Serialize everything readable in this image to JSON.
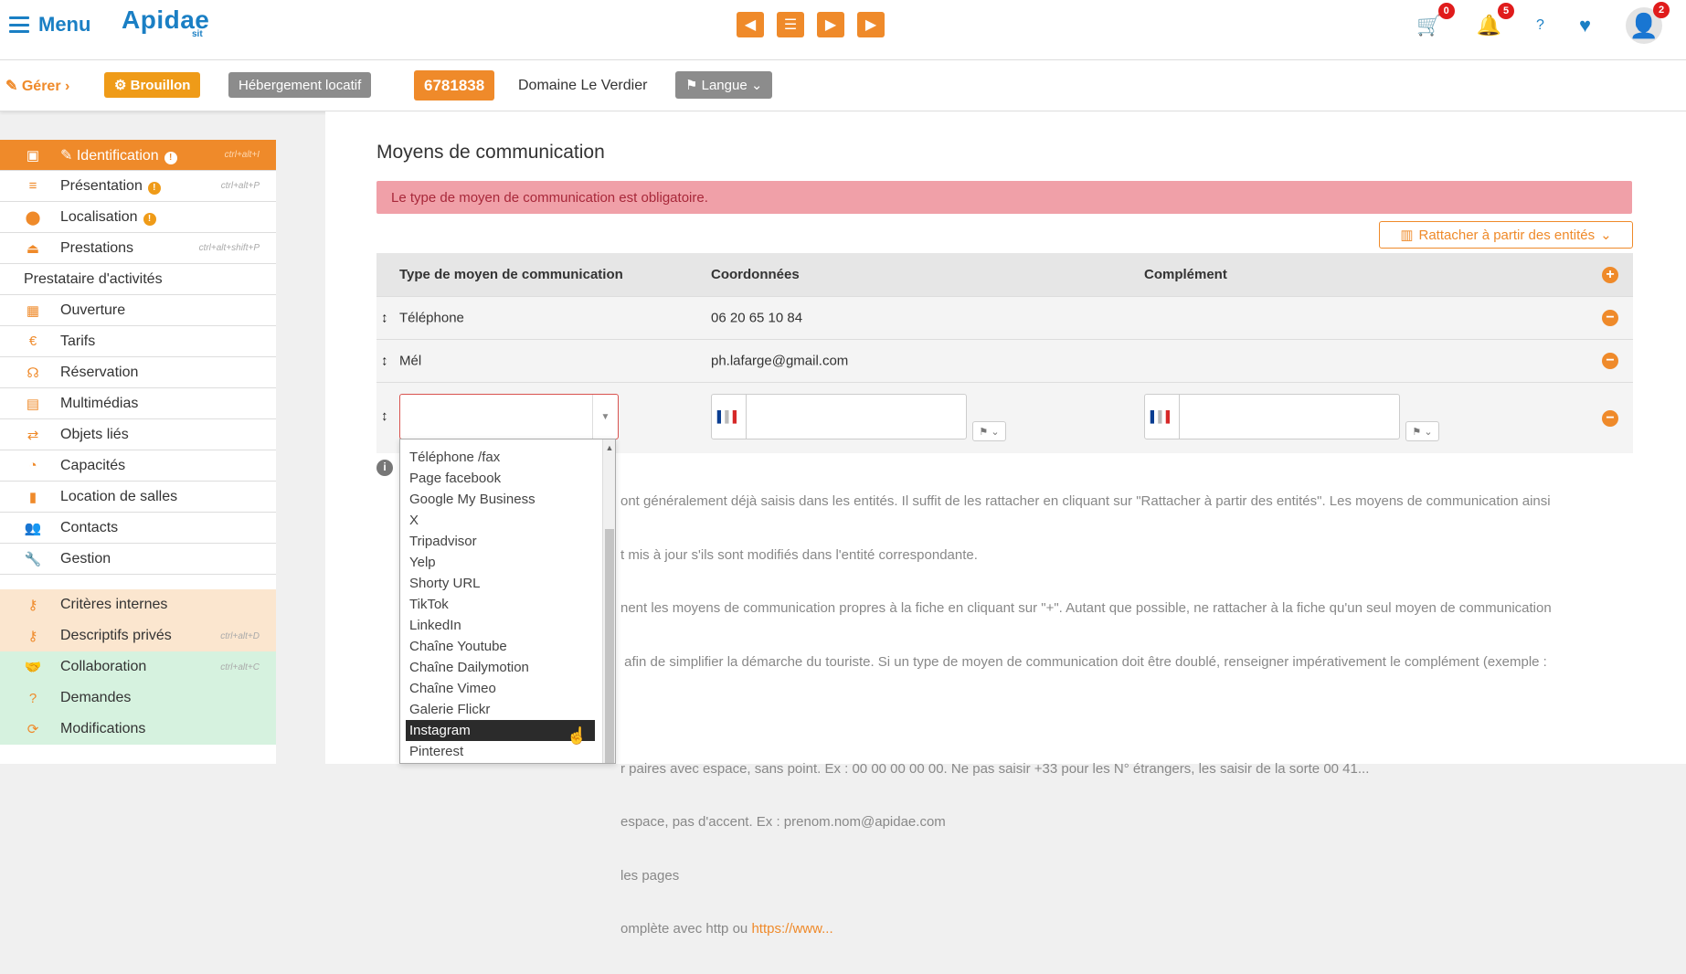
{
  "header": {
    "menu_label": "Menu",
    "logo": "Apidae",
    "logo_sub": "sit",
    "nav_icons": [
      "prev-icon",
      "list-icon",
      "next-icon",
      "play-icon"
    ],
    "cart_badge": "0",
    "notif_badge": "5",
    "help_label": "?",
    "avatar_badge": "2"
  },
  "subbar": {
    "gerer": "Gérer",
    "brouillon": "Brouillon",
    "type": "Hébergement locatif",
    "id": "6781838",
    "domaine": "Domaine Le Verdier",
    "langue": "Langue"
  },
  "sidebar": {
    "items": [
      {
        "label": "Identification",
        "shortcut": "ctrl+alt+I",
        "warn": true,
        "active": true
      },
      {
        "label": "Présentation",
        "shortcut": "ctrl+alt+P",
        "warn": true
      },
      {
        "label": "Localisation",
        "shortcut": "",
        "warn": true
      },
      {
        "label": "Prestations",
        "shortcut": "ctrl+alt+shift+P",
        "warn": false
      }
    ],
    "section_label": "Prestataire d'activités",
    "items2": [
      {
        "label": "Ouverture"
      },
      {
        "label": "Tarifs"
      },
      {
        "label": "Réservation"
      },
      {
        "label": "Multimédias"
      },
      {
        "label": "Objets liés"
      },
      {
        "label": "Capacités"
      },
      {
        "label": "Location de salles"
      },
      {
        "label": "Contacts"
      },
      {
        "label": "Gestion"
      }
    ],
    "private_items": [
      {
        "label": "Critères internes",
        "shortcut": ""
      },
      {
        "label": "Descriptifs privés",
        "shortcut": "ctrl+alt+D"
      }
    ],
    "collab_items": [
      {
        "label": "Collaboration",
        "shortcut": "ctrl+alt+C"
      },
      {
        "label": "Demandes",
        "shortcut": ""
      },
      {
        "label": "Modifications",
        "shortcut": ""
      }
    ]
  },
  "main": {
    "title": "Moyens de communication",
    "alert": "Le type de moyen de communication est obligatoire.",
    "rattacher": "Rattacher à partir des entités",
    "columns": [
      "Type de moyen de communication",
      "Coordonnées",
      "Complément"
    ],
    "rows": [
      {
        "type": "Téléphone",
        "coord": "06 20 65 10 84",
        "comp": ""
      },
      {
        "type": "Mél",
        "coord": "ph.lafarge@gmail.com",
        "comp": ""
      }
    ],
    "new_row": {
      "flag_code": "FR",
      "coord_value": "",
      "comp_value": ""
    },
    "info_lines": [
      "ont généralement déjà saisis dans les entités. Il suffit de les rattacher en cliquant sur \"Rattacher à partir des entités\". Les moyens de communication ainsi",
      "t mis à jour s'ils sont modifiés dans l'entité correspondante.",
      "nent les moyens de communication propres à la fiche en cliquant sur \"+\". Autant que possible, ne rattacher à la fiche qu'un seul moyen de communication",
      " afin de simplifier la démarche du touriste. Si un type de moyen de communication doit être doublé, renseigner impérativement le complément (exemple :",
      "",
      "r paires avec espace, sans point. Ex : 00 00 00 00 00. Ne pas saisir +33 pour les N° étrangers, les saisir de la sorte 00 41...",
      "espace, pas d'accent. Ex : prenom.nom@apidae.com",
      "les pages"
    ],
    "info_last_prefix": "omplète avec http ou ",
    "info_last_link": "https://www..."
  },
  "dropdown": {
    "options": [
      "Téléphone /fax",
      "Page facebook",
      "Google My Business",
      "X",
      "Tripadvisor",
      "Yelp",
      "Shorty URL",
      "TikTok",
      "LinkedIn",
      "Chaîne Youtube",
      "Chaîne Dailymotion",
      "Chaîne Vimeo",
      "Galerie Flickr",
      "Instagram",
      "Pinterest"
    ],
    "highlighted": "Instagram"
  },
  "colors": {
    "accent": "#ef8a2a",
    "brand": "#1a7fc4",
    "alert_bg": "#f0a0a8",
    "badge": "#e01b1b"
  }
}
